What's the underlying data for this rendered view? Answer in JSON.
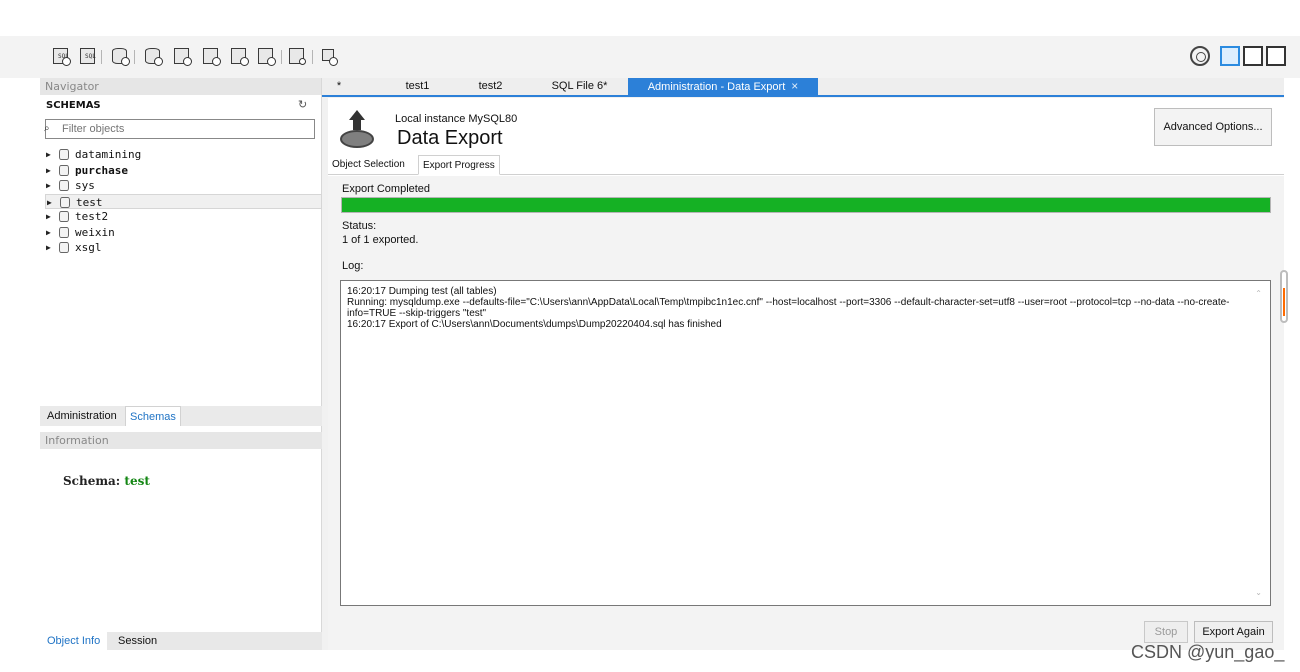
{
  "navigator": {
    "title": "Navigator",
    "section_title": "SCHEMAS",
    "filter_placeholder": "Filter objects",
    "schemas": [
      {
        "name": "datamining",
        "selected": false,
        "bold": false
      },
      {
        "name": "purchase",
        "selected": false,
        "bold": true
      },
      {
        "name": "sys",
        "selected": false,
        "bold": false
      },
      {
        "name": "test",
        "selected": true,
        "bold": false
      },
      {
        "name": "test2",
        "selected": false,
        "bold": false
      },
      {
        "name": "weixin",
        "selected": false,
        "bold": false
      },
      {
        "name": "xsgl",
        "selected": false,
        "bold": false
      }
    ],
    "tabs": [
      "Administration",
      "Schemas"
    ],
    "active_tab": "Schemas"
  },
  "information": {
    "title": "Information",
    "schema_label": "Schema:",
    "schema_value": "test"
  },
  "bottom_tabs": [
    "Object Info",
    "Session"
  ],
  "document_tabs": [
    {
      "label": "*",
      "active": false
    },
    {
      "label": "test1",
      "active": false
    },
    {
      "label": "test2",
      "active": false
    },
    {
      "label": "SQL File 6*",
      "active": false
    },
    {
      "label": "Administration - Data Export",
      "active": true
    }
  ],
  "export_page": {
    "instance": "Local instance MySQL80",
    "title": "Data Export",
    "advanced_button": "Advanced Options...",
    "sections": [
      {
        "label": "Object Selection",
        "active": false
      },
      {
        "label": "Export Progress",
        "active": true
      }
    ],
    "progress_label": "Export Completed",
    "progress": 1,
    "status_label": "Status:",
    "status_value": "1 of 1 exported.",
    "log_label": "Log:",
    "log_lines": [
      "16:20:17 Dumping test (all tables)",
      "Running: mysqldump.exe --defaults-file=\"C:\\Users\\ann\\AppData\\Local\\Temp\\tmpibc1n1ec.cnf\"  --host=localhost --port=3306 --default-character-set=utf8 --user=root --protocol=tcp --no-data --no-create-info=TRUE --skip-triggers \"test\"",
      "16:20:17 Export of C:\\Users\\ann\\Documents\\dumps\\Dump20220404.sql has finished"
    ],
    "stop_button": "Stop",
    "export_again_button": "Export Again"
  },
  "toolbar": {
    "icons": [
      "new-sql-tab-icon",
      "open-sql-script-icon",
      "db-info-icon",
      "create-schema-icon",
      "create-table-icon",
      "create-view-icon",
      "create-procedure-icon",
      "create-function-icon",
      "search-table-icon",
      "reconnect-icon"
    ],
    "right_icons": [
      "preferences-icon",
      "toggle-sidebar-icon",
      "toggle-output-icon",
      "toggle-secondary-sidebar-icon"
    ]
  },
  "watermark": "CSDN @yun_gao_",
  "colors": {
    "accent": "#2c80d8",
    "progress": "#15b124",
    "schema_value": "#138613"
  }
}
